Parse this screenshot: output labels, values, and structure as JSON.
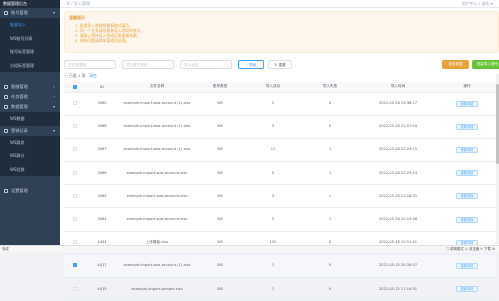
{
  "app": {
    "title": "数据管理后台"
  },
  "header": {
    "crumb": "号 / 导入管理",
    "right": "用户中心 | 退出 ▾"
  },
  "sidebar": {
    "groups": [
      {
        "label": "账号管理",
        "chevron": "▾",
        "icon": "user-icon",
        "items": [
          {
            "label": "批量导入",
            "active": true
          },
          {
            "label": "WS账号列表",
            "active": false
          },
          {
            "label": "账号标签管理",
            "active": false
          },
          {
            "label": "分组标签管理",
            "active": false
          }
        ]
      },
      {
        "label": "客服管理",
        "chevron": "›",
        "icon": "headset-icon",
        "items": []
      },
      {
        "label": "任务管理",
        "chevron": "›",
        "icon": "list-icon",
        "items": []
      },
      {
        "label": "数据管理",
        "chevron": "▾",
        "icon": "chart-icon",
        "items": [
          {
            "label": "WS数据",
            "active": false
          }
        ]
      },
      {
        "label": "营销记录",
        "chevron": "▾",
        "icon": "message-icon",
        "items": [
          {
            "label": "WS群发",
            "active": false
          },
          {
            "label": "WS群分",
            "active": false
          },
          {
            "label": "WS拉群",
            "active": false
          }
        ]
      },
      {
        "label": "设置管理",
        "chevron": "",
        "icon": "gear-icon",
        "items": []
      }
    ]
  },
  "notice": {
    "title": "温馨提示",
    "lines": [
      "1. 批量导入需按照模板格式填写。",
      "2. 同一个任务请勿重复导入相同的账号。",
      "3. 请耐心等待导入完成后再查看结果。",
      "4. 如有问题请联系管理员处理。"
    ]
  },
  "filters": {
    "file_placeholder": "文件名搜索",
    "account_type_placeholder": "导入账号类型",
    "status_placeholder": "导入状态",
    "search_label": "搜索",
    "reset_label": "重置",
    "export_label": "导出数据",
    "batch_import_label": "批量导入账号"
  },
  "selection": {
    "text": "已选 1 项",
    "clear": "清空"
  },
  "table": {
    "headers": [
      "",
      "ID",
      "文件名称",
      "账号类型",
      "导入成功",
      "导入失败",
      "导入时间",
      "操作"
    ],
    "rows": [
      {
        "checked": false,
        "id": "3060",
        "name": "example-import-was-account (1).xlsx",
        "type": "WS",
        "success": "2",
        "fail": "0",
        "time": "2022-05-26 23:38:17",
        "action": "查看详情"
      },
      {
        "checked": false,
        "id": "3068",
        "name": "example-import-was-account (1).xlsx",
        "type": "WS",
        "success": "3",
        "fail": "0",
        "time": "2022-05-26 22:57:04",
        "action": "查看详情"
      },
      {
        "checked": false,
        "id": "3067",
        "name": "example-import-was-account (1).xlsx",
        "type": "WS",
        "success": "11",
        "fail": "1",
        "time": "2022-05-26 22:24:15",
        "action": "查看详情"
      },
      {
        "checked": false,
        "id": "3066",
        "name": "example-import-was-account.xlsx",
        "type": "WS",
        "success": "5",
        "fail": "1",
        "time": "2022-05-26 22:20:14",
        "action": "查看详情"
      },
      {
        "checked": false,
        "id": "3065",
        "name": "example-import-was-account.xlsx",
        "type": "WS",
        "success": "3",
        "fail": "1",
        "time": "2022-05-26 22:18:55",
        "action": "查看详情"
      },
      {
        "checked": false,
        "id": "3064",
        "name": "example-import-was-account.xlsx",
        "type": "WS",
        "success": "5",
        "fail": "1",
        "time": "2022-05-26 22:19:48",
        "action": "查看详情"
      },
      {
        "checked": false,
        "id": "4434",
        "name": "上传模板.xlsx",
        "type": "WS",
        "success": "102",
        "fail": "0",
        "time": "2022-05-18 10:51:41",
        "action": "查看详情"
      },
      {
        "checked": true,
        "id": "4417",
        "name": "example-import-was-account (1).xlsx",
        "type": "WS",
        "success": "1",
        "fail": "0",
        "time": "2022-05-15 20:34:07",
        "action": "查看详情"
      },
      {
        "checked": false,
        "id": "4415",
        "name": "example-import-sample.xlsx",
        "type": "WS",
        "success": "1",
        "fail": "0",
        "time": "2022-05-15 17:14:51",
        "action": "查看详情"
      }
    ]
  },
  "statusbar": {
    "left": "完成",
    "right": "□ 精简模式  ◎ 浏览器  ⊙ 下载  ⚙"
  },
  "colors": {
    "accent": "#409eff",
    "warning": "#e6a23c",
    "success": "#67c23a",
    "sidebar": "#304156"
  }
}
